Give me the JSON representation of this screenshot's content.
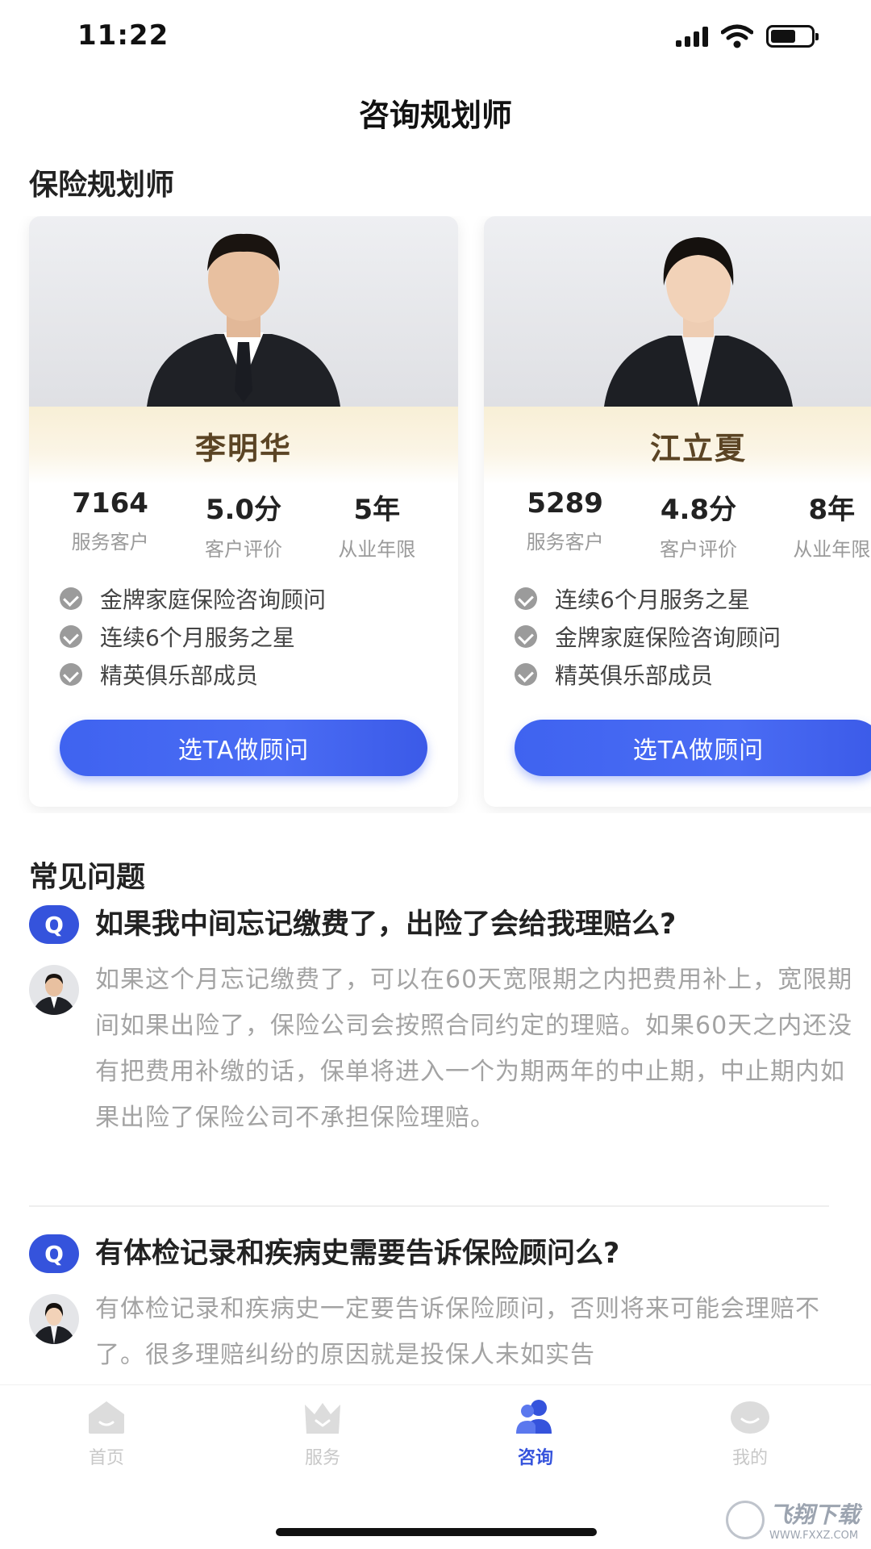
{
  "status_bar": {
    "time": "11:22"
  },
  "header": {
    "title": "咨询规划师"
  },
  "planners_section": {
    "title": "保险规划师"
  },
  "planners": [
    {
      "name": "李明华",
      "stats": [
        {
          "value": "7164",
          "label": "服务客户"
        },
        {
          "value": "5.0分",
          "label": "客户评价"
        },
        {
          "value": "5年",
          "label": "从业年限"
        }
      ],
      "honors": [
        "金牌家庭保险咨询顾问",
        "连续6个月服务之星",
        "精英俱乐部成员"
      ],
      "button_label": "选TA做顾问"
    },
    {
      "name": "江立夏",
      "stats": [
        {
          "value": "5289",
          "label": "服务客户"
        },
        {
          "value": "4.8分",
          "label": "客户评价"
        },
        {
          "value": "8年",
          "label": "从业年限"
        }
      ],
      "honors": [
        "连续6个月服务之星",
        "金牌家庭保险咨询顾问",
        "精英俱乐部成员"
      ],
      "button_label": "选TA做顾问"
    }
  ],
  "faq": {
    "title": "常见问题",
    "items": [
      {
        "badge": "Q",
        "question": "如果我中间忘记缴费了，出险了会给我理赔么?",
        "answer": "如果这个月忘记缴费了，可以在60天宽限期之内把费用补上，宽限期间如果出险了，保险公司会按照合同约定的理赔。如果60天之内还没有把费用补缴的话，保单将进入一个为期两年的中止期，中止期内如果出险了保险公司不承担保险理赔。"
      },
      {
        "badge": "Q",
        "question": "有体检记录和疾病史需要告诉保险顾问么?",
        "answer": "有体检记录和疾病史一定要告诉保险顾问，否则将来可能会理赔不了。很多理赔纠纷的原因就是投保人未如实告"
      }
    ]
  },
  "tabs": [
    {
      "label": "首页",
      "icon": "home-icon"
    },
    {
      "label": "服务",
      "icon": "crown-icon"
    },
    {
      "label": "咨询",
      "icon": "consult-users-icon",
      "active": true
    },
    {
      "label": "我的",
      "icon": "profile-smile-icon"
    }
  ],
  "watermark": {
    "text": "飞翔下载",
    "url": "WWW.FXXZ.COM"
  },
  "colors": {
    "accent": "#3553dc",
    "button": "#4568f2",
    "name_banner": "#f8efd6"
  }
}
